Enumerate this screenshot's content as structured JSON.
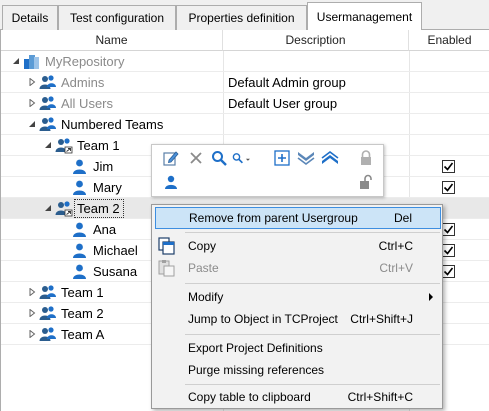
{
  "tabs": [
    {
      "label": "Details"
    },
    {
      "label": "Test configuration"
    },
    {
      "label": "Properties definition"
    },
    {
      "label": "Usermanagement"
    }
  ],
  "columns": {
    "name": "Name",
    "description": "Description",
    "enabled": "Enabled"
  },
  "rows": [
    {
      "name": "MyRepository",
      "description": "",
      "icon": "repository-icon",
      "level": 0,
      "expander": "expanded",
      "enabled": null,
      "grey": true
    },
    {
      "name": "Admins",
      "description": "Default Admin group",
      "icon": "usergroup-icon",
      "level": 1,
      "expander": "collapsed",
      "enabled": null,
      "grey": true
    },
    {
      "name": "All Users",
      "description": "Default User group",
      "icon": "usergroup-icon",
      "level": 1,
      "expander": "collapsed",
      "enabled": null,
      "grey": true
    },
    {
      "name": "Numbered Teams",
      "description": "",
      "icon": "usergroup-icon",
      "level": 1,
      "expander": "expanded",
      "enabled": null,
      "grey": false
    },
    {
      "name": "Team 1",
      "description": "",
      "icon": "usergroup-link-icon",
      "level": 2,
      "expander": "expanded",
      "enabled": null,
      "grey": false
    },
    {
      "name": "Jim",
      "description": "",
      "icon": "user-icon",
      "level": 3,
      "expander": "none",
      "enabled": true,
      "grey": false
    },
    {
      "name": "Mary",
      "description": "",
      "icon": "user-icon",
      "level": 3,
      "expander": "none",
      "enabled": true,
      "grey": false
    },
    {
      "name": "Team 2",
      "description": "",
      "icon": "usergroup-link-icon",
      "level": 2,
      "expander": "expanded",
      "enabled": null,
      "grey": false,
      "selected": true
    },
    {
      "name": "Ana",
      "description": "",
      "icon": "user-icon",
      "level": 3,
      "expander": "none",
      "enabled": true,
      "grey": false
    },
    {
      "name": "Michael",
      "description": "",
      "icon": "user-icon",
      "level": 3,
      "expander": "none",
      "enabled": true,
      "grey": false
    },
    {
      "name": "Susana",
      "description": "",
      "icon": "user-icon",
      "level": 3,
      "expander": "none",
      "enabled": true,
      "grey": false
    },
    {
      "name": "Team 1",
      "description": "",
      "icon": "usergroup-icon",
      "level": 1,
      "expander": "collapsed",
      "enabled": null,
      "grey": false
    },
    {
      "name": "Team 2",
      "description": "",
      "icon": "usergroup-icon",
      "level": 1,
      "expander": "collapsed",
      "enabled": null,
      "grey": false
    },
    {
      "name": "Team A",
      "description": "",
      "icon": "usergroup-icon",
      "level": 1,
      "expander": "collapsed",
      "enabled": null,
      "grey": false
    }
  ],
  "mini_toolbar": {
    "icons": [
      "edit-icon",
      "delete-icon",
      "search-icon",
      "search-dropdown-icon",
      "expand-all-icon",
      "collapse-all-icon",
      "move-up-icon",
      "lock-icon",
      "add-user-icon",
      "unlock-icon"
    ]
  },
  "context_menu": {
    "items": [
      {
        "label": "Remove from parent Usergroup",
        "shortcut": "Del",
        "highlighted": true,
        "disabled": false,
        "icon": ""
      },
      {
        "label": "Copy",
        "shortcut": "Ctrl+C",
        "highlighted": false,
        "disabled": false,
        "icon": "copy-icon"
      },
      {
        "label": "Paste",
        "shortcut": "Ctrl+V",
        "highlighted": false,
        "disabled": true,
        "icon": "paste-icon"
      },
      {
        "label": "Modify",
        "shortcut": "",
        "highlighted": false,
        "disabled": false,
        "submenu": true,
        "icon": ""
      },
      {
        "label": "Jump to Object in TCProject",
        "shortcut": "Ctrl+Shift+J",
        "highlighted": false,
        "disabled": false,
        "icon": ""
      },
      {
        "label": "Export Project Definitions",
        "shortcut": "",
        "highlighted": false,
        "disabled": false,
        "icon": ""
      },
      {
        "label": "Purge missing references",
        "shortcut": "",
        "highlighted": false,
        "disabled": false,
        "icon": ""
      },
      {
        "label": "Copy table to clipboard",
        "shortcut": "Ctrl+Shift+C",
        "highlighted": false,
        "disabled": false,
        "icon": ""
      }
    ]
  },
  "colors": {
    "user_blue": "#1e6fc8",
    "selection_grey": "#e8e8e8",
    "menu_highlight": "#cce4f7",
    "menu_highlight_border": "#3d8ee0"
  }
}
